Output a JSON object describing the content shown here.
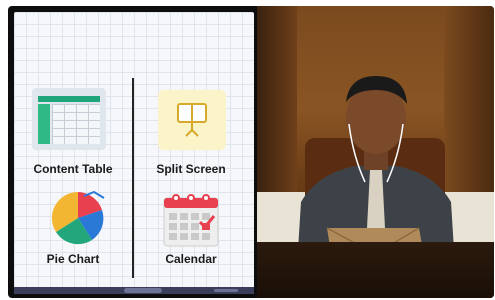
{
  "tiles": [
    {
      "label": "Content Table",
      "icon": "content-table-icon"
    },
    {
      "label": "Split Screen",
      "icon": "split-screen-icon"
    },
    {
      "label": "Pie Chart",
      "icon": "pie-chart-icon"
    },
    {
      "label": "Calendar",
      "icon": "calendar-icon"
    }
  ],
  "colors": {
    "board_bg": "#f6f7fb",
    "grid_line": "#dfe3ea",
    "table_accent": "#1ea57a",
    "split_bg": "#fbf4c8",
    "calendar_red": "#e8404f",
    "frame": "#0d0d0d"
  },
  "photo": {
    "subject": "person-holding-tablet"
  }
}
